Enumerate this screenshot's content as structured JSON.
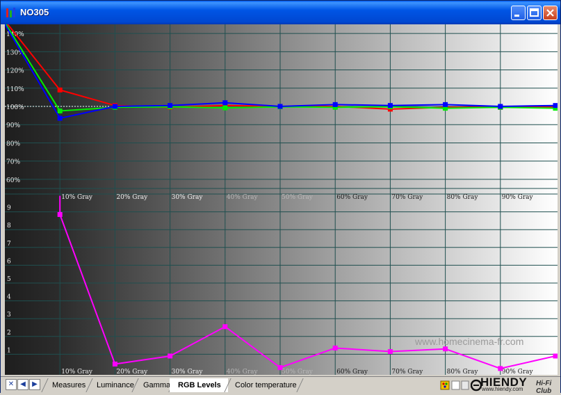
{
  "window": {
    "title": "NO305"
  },
  "watermark": "www.homecinema-fr.com",
  "tabs": [
    {
      "label": "Measures",
      "active": false
    },
    {
      "label": "Luminance",
      "active": false
    },
    {
      "label": "Gamma",
      "active": false
    },
    {
      "label": "RGB Levels",
      "active": true
    },
    {
      "label": "Color temperature",
      "active": false
    }
  ],
  "nav": {
    "close": "✕",
    "prev": "◀",
    "next": "▶"
  },
  "logo": {
    "name": "HIENDY",
    "sub": "www.hiendy.com",
    "club": "Hi-Fi Club"
  },
  "chart_data": [
    {
      "type": "line",
      "panel": "rgb-levels",
      "x_categories": [
        "10% Gray",
        "20% Gray",
        "30% Gray",
        "40% Gray",
        "50% Gray",
        "60% Gray",
        "70% Gray",
        "80% Gray",
        "90% Gray"
      ],
      "y_ticks": [
        "140%",
        "130%",
        "120%",
        "110%",
        "100%",
        "90%",
        "80%",
        "70%",
        "60%"
      ],
      "ylim": [
        55,
        145
      ],
      "grid": true,
      "reference": 100,
      "series": [
        {
          "color": "#ff0000",
          "x": [
            0,
            10,
            20,
            30,
            40,
            50,
            60,
            70,
            80,
            90,
            100
          ],
          "values": [
            147,
            109,
            100.5,
            99.5,
            100.5,
            100,
            100,
            98.5,
            99.5,
            99.5,
            99.5
          ]
        },
        {
          "color": "#00ee00",
          "x": [
            0,
            10,
            20,
            30,
            40,
            50,
            60,
            70,
            80,
            90,
            100
          ],
          "values": [
            146,
            97.5,
            99.5,
            99.8,
            99.2,
            99.8,
            99.5,
            99.8,
            99,
            99.5,
            99
          ]
        },
        {
          "color": "#0000ff",
          "x": [
            0,
            10,
            20,
            30,
            40,
            50,
            60,
            70,
            80,
            90,
            100
          ],
          "values": [
            145,
            93.5,
            100,
            100.5,
            102,
            100,
            101,
            100.5,
            101,
            100,
            100.5
          ]
        }
      ]
    },
    {
      "type": "line",
      "panel": "delta",
      "x_categories": [
        "10% Gray",
        "20% Gray",
        "30% Gray",
        "40% Gray",
        "50% Gray",
        "60% Gray",
        "70% Gray",
        "80% Gray",
        "90% Gray"
      ],
      "y_ticks": [
        "9",
        "8",
        "7",
        "6",
        "5",
        "4",
        "3",
        "2",
        "1"
      ],
      "ylim": [
        0,
        10
      ],
      "grid": true,
      "series": [
        {
          "color": "#ff00ff",
          "x": [
            10,
            10,
            20,
            30,
            40,
            50,
            60,
            70,
            80,
            90,
            100
          ],
          "values": [
            9.9,
            8.85,
            0.45,
            0.9,
            2.55,
            0.25,
            1.35,
            1.15,
            1.3,
            0.2,
            0.9
          ]
        }
      ]
    }
  ]
}
